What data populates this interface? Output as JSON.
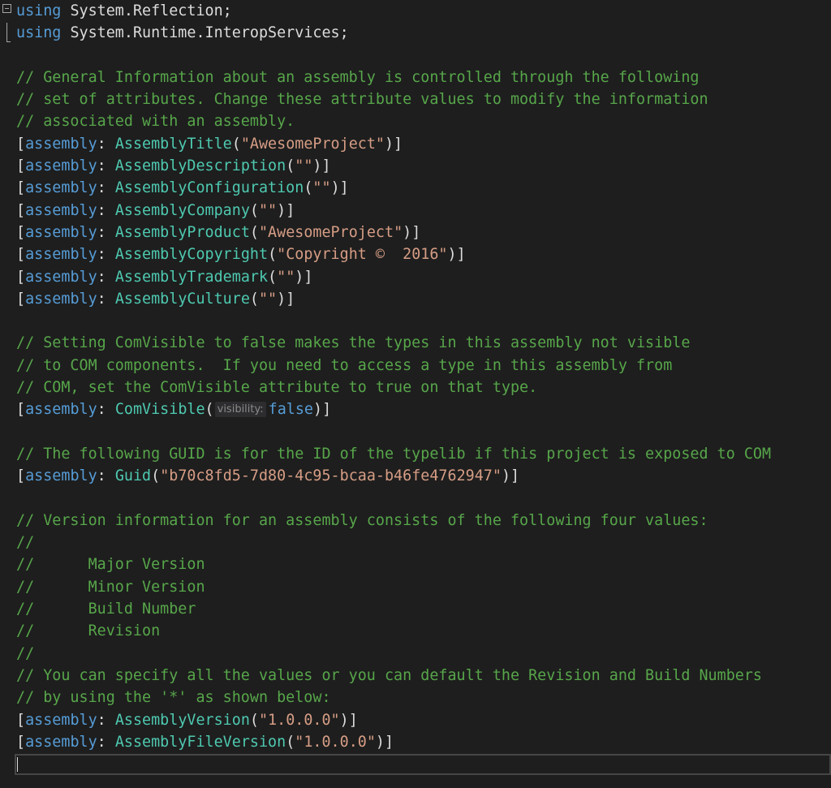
{
  "editor": {
    "lines": [
      [
        {
          "t": "kw",
          "v": "using"
        },
        {
          "t": "punc",
          "v": " System.Reflection;"
        }
      ],
      [
        {
          "t": "kw",
          "v": "using"
        },
        {
          "t": "punc",
          "v": " System.Runtime.InteropServices;"
        }
      ],
      [],
      [
        {
          "t": "cmt",
          "v": "// General Information about an assembly is controlled through the following"
        }
      ],
      [
        {
          "t": "cmt",
          "v": "// set of attributes. Change these attribute values to modify the information"
        }
      ],
      [
        {
          "t": "cmt",
          "v": "// associated with an assembly."
        }
      ],
      [
        {
          "t": "punc",
          "v": "["
        },
        {
          "t": "kw",
          "v": "assembly"
        },
        {
          "t": "punc",
          "v": ": "
        },
        {
          "t": "type",
          "v": "AssemblyTitle"
        },
        {
          "t": "punc",
          "v": "("
        },
        {
          "t": "str",
          "v": "\"AwesomeProject\""
        },
        {
          "t": "punc",
          "v": ")]"
        }
      ],
      [
        {
          "t": "punc",
          "v": "["
        },
        {
          "t": "kw",
          "v": "assembly"
        },
        {
          "t": "punc",
          "v": ": "
        },
        {
          "t": "type",
          "v": "AssemblyDescription"
        },
        {
          "t": "punc",
          "v": "("
        },
        {
          "t": "str",
          "v": "\"\""
        },
        {
          "t": "punc",
          "v": ")]"
        }
      ],
      [
        {
          "t": "punc",
          "v": "["
        },
        {
          "t": "kw",
          "v": "assembly"
        },
        {
          "t": "punc",
          "v": ": "
        },
        {
          "t": "type",
          "v": "AssemblyConfiguration"
        },
        {
          "t": "punc",
          "v": "("
        },
        {
          "t": "str",
          "v": "\"\""
        },
        {
          "t": "punc",
          "v": ")]"
        }
      ],
      [
        {
          "t": "punc",
          "v": "["
        },
        {
          "t": "kw",
          "v": "assembly"
        },
        {
          "t": "punc",
          "v": ": "
        },
        {
          "t": "type",
          "v": "AssemblyCompany"
        },
        {
          "t": "punc",
          "v": "("
        },
        {
          "t": "str",
          "v": "\"\""
        },
        {
          "t": "punc",
          "v": ")]"
        }
      ],
      [
        {
          "t": "punc",
          "v": "["
        },
        {
          "t": "kw",
          "v": "assembly"
        },
        {
          "t": "punc",
          "v": ": "
        },
        {
          "t": "type",
          "v": "AssemblyProduct"
        },
        {
          "t": "punc",
          "v": "("
        },
        {
          "t": "str",
          "v": "\"AwesomeProject\""
        },
        {
          "t": "punc",
          "v": ")]"
        }
      ],
      [
        {
          "t": "punc",
          "v": "["
        },
        {
          "t": "kw",
          "v": "assembly"
        },
        {
          "t": "punc",
          "v": ": "
        },
        {
          "t": "type",
          "v": "AssemblyCopyright"
        },
        {
          "t": "punc",
          "v": "("
        },
        {
          "t": "str",
          "v": "\"Copyright ©  2016\""
        },
        {
          "t": "punc",
          "v": ")]"
        }
      ],
      [
        {
          "t": "punc",
          "v": "["
        },
        {
          "t": "kw",
          "v": "assembly"
        },
        {
          "t": "punc",
          "v": ": "
        },
        {
          "t": "type",
          "v": "AssemblyTrademark"
        },
        {
          "t": "punc",
          "v": "("
        },
        {
          "t": "str",
          "v": "\"\""
        },
        {
          "t": "punc",
          "v": ")]"
        }
      ],
      [
        {
          "t": "punc",
          "v": "["
        },
        {
          "t": "kw",
          "v": "assembly"
        },
        {
          "t": "punc",
          "v": ": "
        },
        {
          "t": "type",
          "v": "AssemblyCulture"
        },
        {
          "t": "punc",
          "v": "("
        },
        {
          "t": "str",
          "v": "\"\""
        },
        {
          "t": "punc",
          "v": ")]"
        }
      ],
      [],
      [
        {
          "t": "cmt",
          "v": "// Setting ComVisible to false makes the types in this assembly not visible"
        }
      ],
      [
        {
          "t": "cmt",
          "v": "// to COM components.  If you need to access a type in this assembly from"
        }
      ],
      [
        {
          "t": "cmt",
          "v": "// COM, set the ComVisible attribute to true on that type."
        }
      ],
      [
        {
          "t": "punc",
          "v": "["
        },
        {
          "t": "kw",
          "v": "assembly"
        },
        {
          "t": "punc",
          "v": ": "
        },
        {
          "t": "type",
          "v": "ComVisible"
        },
        {
          "t": "punc",
          "v": "("
        },
        {
          "t": "hint",
          "v": "visibility:"
        },
        {
          "t": "kw",
          "v": "false"
        },
        {
          "t": "punc",
          "v": ")]"
        }
      ],
      [],
      [
        {
          "t": "cmt",
          "v": "// The following GUID is for the ID of the typelib if this project is exposed to COM"
        }
      ],
      [
        {
          "t": "punc",
          "v": "["
        },
        {
          "t": "kw",
          "v": "assembly"
        },
        {
          "t": "punc",
          "v": ": "
        },
        {
          "t": "type",
          "v": "Guid"
        },
        {
          "t": "punc",
          "v": "("
        },
        {
          "t": "str",
          "v": "\"b70c8fd5-7d80-4c95-bcaa-b46fe4762947\""
        },
        {
          "t": "punc",
          "v": ")]"
        }
      ],
      [],
      [
        {
          "t": "cmt",
          "v": "// Version information for an assembly consists of the following four values:"
        }
      ],
      [
        {
          "t": "cmt",
          "v": "//"
        }
      ],
      [
        {
          "t": "cmt",
          "v": "//      Major Version"
        }
      ],
      [
        {
          "t": "cmt",
          "v": "//      Minor Version"
        }
      ],
      [
        {
          "t": "cmt",
          "v": "//      Build Number"
        }
      ],
      [
        {
          "t": "cmt",
          "v": "//      Revision"
        }
      ],
      [
        {
          "t": "cmt",
          "v": "//"
        }
      ],
      [
        {
          "t": "cmt",
          "v": "// You can specify all the values or you can default the Revision and Build Numbers"
        }
      ],
      [
        {
          "t": "cmt",
          "v": "// by using the '*' as shown below:"
        }
      ],
      [
        {
          "t": "punc",
          "v": "["
        },
        {
          "t": "kw",
          "v": "assembly"
        },
        {
          "t": "punc",
          "v": ": "
        },
        {
          "t": "type",
          "v": "AssemblyVersion"
        },
        {
          "t": "punc",
          "v": "("
        },
        {
          "t": "str",
          "v": "\"1.0.0.0\""
        },
        {
          "t": "punc",
          "v": ")]"
        }
      ],
      [
        {
          "t": "punc",
          "v": "["
        },
        {
          "t": "kw",
          "v": "assembly"
        },
        {
          "t": "punc",
          "v": ": "
        },
        {
          "t": "type",
          "v": "AssemblyFileVersion"
        },
        {
          "t": "punc",
          "v": "("
        },
        {
          "t": "str",
          "v": "\"1.0.0.0\""
        },
        {
          "t": "punc",
          "v": ")]"
        }
      ],
      []
    ]
  },
  "icons": {
    "fold": "collapse-region-icon"
  },
  "colors": {
    "background": "#1e1e1e",
    "keyword": "#569cd6",
    "type": "#4ec9b0",
    "string": "#d69d85",
    "comment": "#57a64a",
    "text": "#dcdcdc",
    "hint_background": "#2d2d30",
    "hint_text": "#8a8a8a"
  }
}
